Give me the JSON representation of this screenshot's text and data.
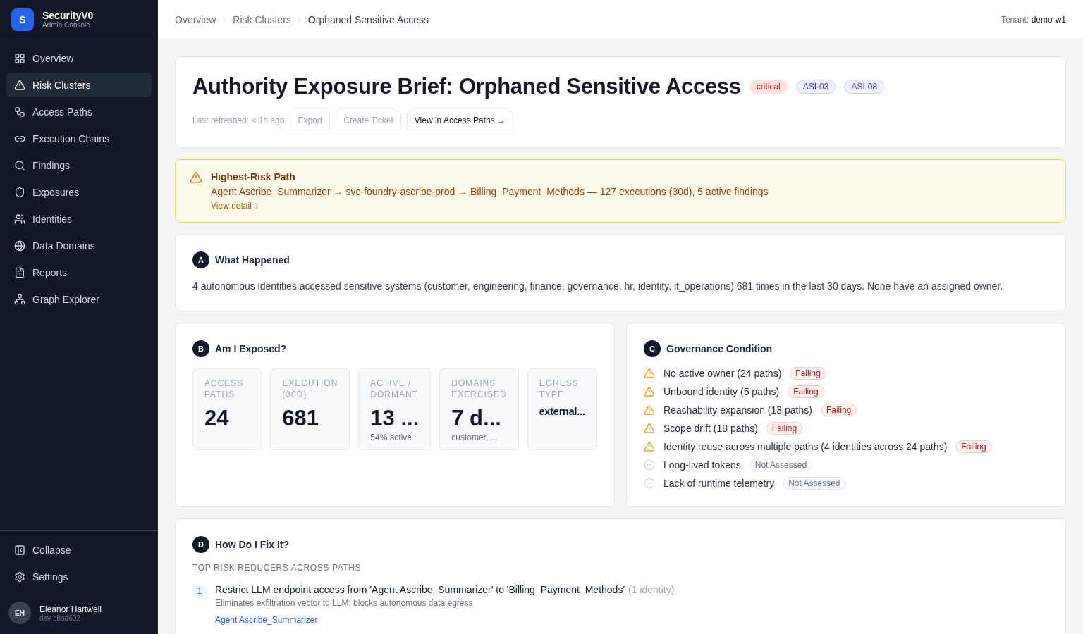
{
  "brand": {
    "logo": "S",
    "name": "SecurityV0",
    "subtitle": "Admin Console"
  },
  "nav": [
    {
      "label": "Overview",
      "selected": false
    },
    {
      "label": "Risk Clusters",
      "selected": true
    },
    {
      "label": "Access Paths",
      "selected": false
    },
    {
      "label": "Execution Chains",
      "selected": false
    },
    {
      "label": "Findings",
      "selected": false
    },
    {
      "label": "Exposures",
      "selected": false
    },
    {
      "label": "Identities",
      "selected": false
    },
    {
      "label": "Data Domains",
      "selected": false
    },
    {
      "label": "Reports",
      "selected": false
    },
    {
      "label": "Graph Explorer",
      "selected": false
    }
  ],
  "sidebar_footer": [
    {
      "label": "Collapse"
    },
    {
      "label": "Settings"
    }
  ],
  "user": {
    "initials": "EH",
    "name": "Eleanor Hartwell",
    "id": "dev-c8ad602"
  },
  "breadcrumbs": [
    "Overview",
    "Risk Clusters",
    "Orphaned Sensitive Access"
  ],
  "tenant": {
    "label": "Tenant:",
    "value": "demo-w1"
  },
  "brief": {
    "title": "Authority Exposure Brief: Orphaned Sensitive Access",
    "tags": [
      {
        "label": "critical",
        "kind": "severity"
      },
      {
        "label": "ASI-03",
        "kind": "code"
      },
      {
        "label": "ASI-08",
        "kind": "code"
      }
    ],
    "refreshed": "Last refreshed: < 1h ago",
    "actions": [
      {
        "label": "Export",
        "disabled": true
      },
      {
        "label": "Create Ticket",
        "disabled": true
      },
      {
        "label": "View in Access Paths →",
        "disabled": false
      }
    ]
  },
  "alert": {
    "title": "Highest-Risk Path",
    "text": "Agent Ascribe_Summarizer → svc-foundry-ascribe-prod → Billing_Payment_Methods — 127 executions (30d), 5 active findings",
    "link": "View detail"
  },
  "what_happened": {
    "letter": "A",
    "title": "What Happened",
    "text": "4 autonomous identities accessed sensitive systems (customer, engineering, finance, governance, hr, identity, it_operations) 681 times in the last 30 days. None have an assigned owner."
  },
  "exposed": {
    "letter": "B",
    "title": "Am I Exposed?",
    "metrics": [
      {
        "label": "ACCESS PATHS",
        "value": "24",
        "kind": "big"
      },
      {
        "label": "EXECUTION (30D)",
        "value": "681",
        "kind": "big"
      },
      {
        "label": "ACTIVE / DORMANT",
        "value": "13 ...",
        "note": "54% active",
        "kind": "big"
      },
      {
        "label": "DOMAINS EXERCISED",
        "value": "7 d...",
        "note": "customer, ...",
        "kind": "big"
      },
      {
        "label": "EGRESS TYPE",
        "value": "external...",
        "kind": "small"
      }
    ]
  },
  "governance": {
    "letter": "C",
    "title": "Governance Condition",
    "items": [
      {
        "text": "No active owner (24 paths)",
        "status": "Failing",
        "kind": "failing"
      },
      {
        "text": "Unbound identity (5 paths)",
        "status": "Failing",
        "kind": "failing"
      },
      {
        "text": "Reachability expansion (13 paths)",
        "status": "Failing",
        "kind": "failing"
      },
      {
        "text": "Scope drift (18 paths)",
        "status": "Failing",
        "kind": "failing"
      },
      {
        "text": "Identity reuse across multiple paths (4 identities across 24 paths)",
        "status": "Failing",
        "kind": "failing"
      },
      {
        "text": "Long-lived tokens",
        "status": "Not Assessed",
        "kind": "not_assessed"
      },
      {
        "text": "Lack of runtime telemetry",
        "status": "Not Assessed",
        "kind": "not_assessed"
      }
    ]
  },
  "fix": {
    "letter": "D",
    "title": "How Do I Fix It?",
    "subtitle": "TOP RISK REDUCERS ACROSS PATHS",
    "items": [
      {
        "number": "1",
        "title": "Restrict LLM endpoint access from 'Agent Ascribe_Summarizer' to 'Billing_Payment_Methods'",
        "count": "(1 identity)",
        "description": "Eliminates exfiltration vector to LLM; blocks autonomous data egress",
        "link": "Agent Ascribe_Summarizer"
      }
    ]
  }
}
